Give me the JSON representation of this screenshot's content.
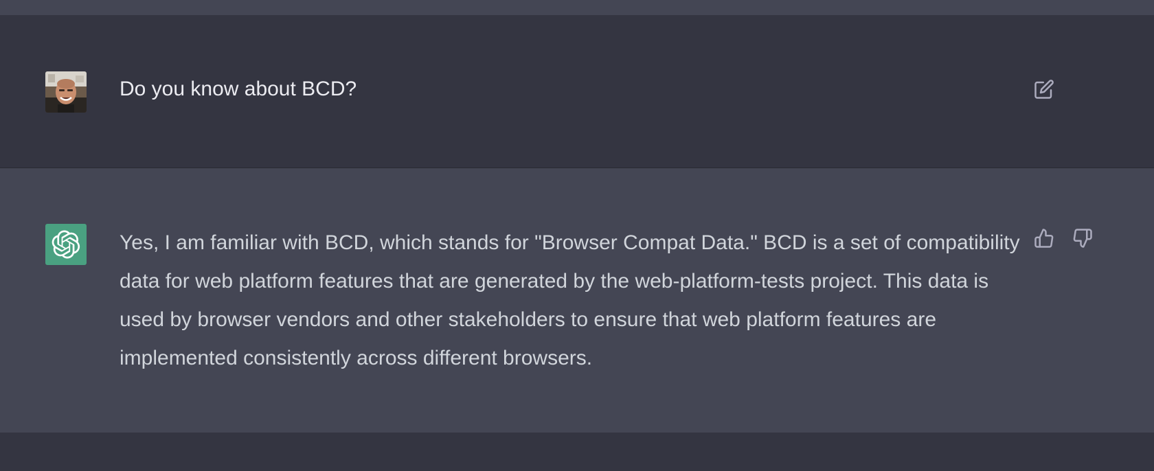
{
  "conversation": {
    "user_message": {
      "author_avatar": "user-photo-avatar",
      "text": "Do you know about BCD?",
      "action_icon": "edit-icon"
    },
    "assistant_message": {
      "author_avatar": "openai-logo-avatar",
      "text": "Yes, I am familiar with BCD, which stands for \"Browser Compat Data.\" BCD is a set of compatibility data for web platform features that are generated by the web-platform-tests project. This data is used by browser vendors and other stakeholders to ensure that web platform features are implemented consistently across different browsers.",
      "feedback_icons": [
        "thumbs-up-icon",
        "thumbs-down-icon"
      ]
    }
  },
  "colors": {
    "page_background": "#343541",
    "assistant_background": "#444654",
    "bot_avatar_background": "#4aa181",
    "user_text": "#ececf1",
    "assistant_text": "#d1d5db",
    "icon": "#acacbe"
  }
}
